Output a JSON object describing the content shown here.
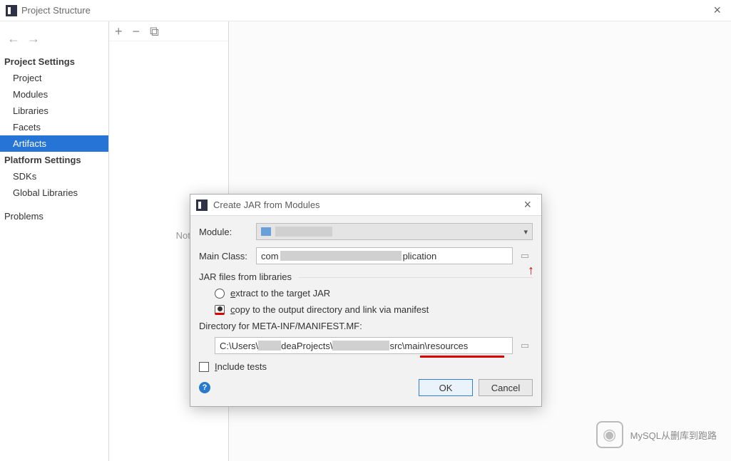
{
  "window": {
    "title": "Project Structure"
  },
  "sidebar": {
    "section1": "Project Settings",
    "items1": [
      "Project",
      "Modules",
      "Libraries",
      "Facets",
      "Artifacts"
    ],
    "selected": "Artifacts",
    "section2": "Platform Settings",
    "items2": [
      "SDKs",
      "Global Libraries"
    ],
    "problems": "Problems"
  },
  "content": {
    "placeholder": "Nothing to s"
  },
  "modal": {
    "title": "Create JAR from Modules",
    "moduleLabel": "Module:",
    "mainClassLabel": "Main Class:",
    "mainClassPrefix": "com",
    "mainClassSuffix": "plication",
    "fieldsetLabel": "JAR files from libraries",
    "radio1_e": "e",
    "radio1_rest": "xtract to the target JAR",
    "radio2_c": "c",
    "radio2_rest": "opy to the output directory and link via manifest",
    "dirLabel": "Directory for META-INF/MANIFEST.MF:",
    "dirPart1": "C:\\Users\\",
    "dirPart2": "deaProjects\\",
    "dirPart3": "src\\main\\resources",
    "includeTests_i": "I",
    "includeTests_rest": "nclude tests",
    "ok": "OK",
    "cancel": "Cancel"
  },
  "watermark": {
    "text": "MySQL从删库到跑路"
  }
}
